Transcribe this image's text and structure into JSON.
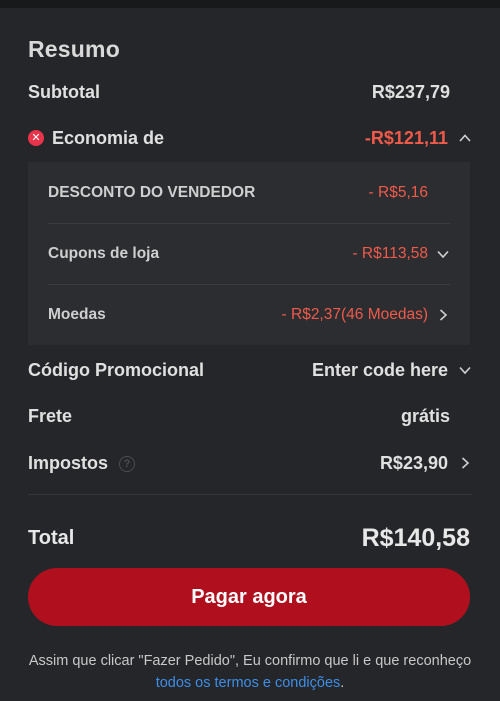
{
  "summary": {
    "title": "Resumo",
    "subtotal": {
      "label": "Subtotal",
      "value": "R$237,79"
    },
    "economia": {
      "label": "Economia de",
      "value": "-R$121,11",
      "expanded": true,
      "items": [
        {
          "label": "DESCONTO DO VENDEDOR",
          "value": "- R$5,16"
        },
        {
          "label": "Cupons de loja",
          "value": "- R$113,58"
        },
        {
          "label": "Moedas",
          "value": "- R$2,37(46 Moedas)"
        }
      ]
    },
    "promo": {
      "label": "Código Promocional",
      "value": "Enter code here"
    },
    "frete": {
      "label": "Frete",
      "value": "grátis"
    },
    "impostos": {
      "label": "Impostos",
      "help": "?",
      "value": "R$23,90"
    },
    "total": {
      "label": "Total",
      "value": "R$140,58"
    }
  },
  "pay_button": {
    "label": "Pagar agora"
  },
  "disclaimer": {
    "text": "Assim que clicar \"Fazer Pedido\", Eu confirmo que li e que reconheço ",
    "link": "todos os termos e condições",
    "end": "."
  },
  "colors": {
    "background": "#252629",
    "discount_red": "#f05a4a",
    "button_red": "#b0101d",
    "link_blue": "#3d8ee8"
  },
  "icons": [
    "close-circle-icon",
    "chevron-up-icon",
    "chevron-down-icon",
    "chevron-right-icon",
    "help-icon"
  ]
}
